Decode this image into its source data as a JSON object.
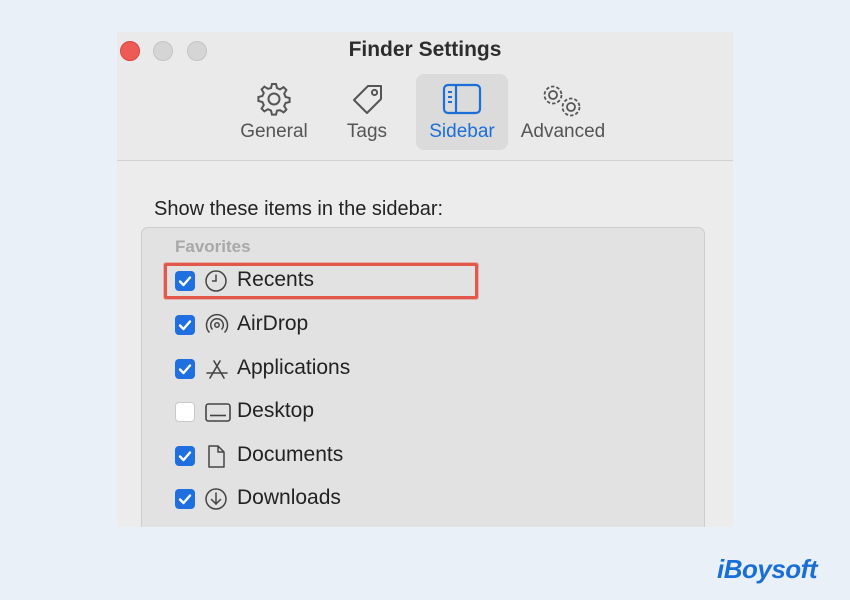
{
  "window": {
    "title": "Finder Settings",
    "tabs": [
      {
        "label": "General",
        "icon": "gear-icon"
      },
      {
        "label": "Tags",
        "icon": "tag-icon"
      },
      {
        "label": "Sidebar",
        "icon": "sidebar-icon",
        "active": true
      },
      {
        "label": "Advanced",
        "icon": "gears-icon"
      }
    ]
  },
  "sidebar_settings": {
    "heading": "Show these items in the sidebar:",
    "section": "Favorites",
    "items": [
      {
        "label": "Recents",
        "checked": true,
        "icon": "clock-icon"
      },
      {
        "label": "AirDrop",
        "checked": true,
        "icon": "airdrop-icon"
      },
      {
        "label": "Applications",
        "checked": true,
        "icon": "applications-icon"
      },
      {
        "label": "Desktop",
        "checked": false,
        "icon": "desktop-icon"
      },
      {
        "label": "Documents",
        "checked": true,
        "icon": "document-icon"
      },
      {
        "label": "Downloads",
        "checked": true,
        "icon": "download-icon"
      }
    ]
  },
  "brand": {
    "text": "iBoysoft"
  },
  "colors": {
    "accent": "#1f6fe0",
    "highlight": "#e4574b",
    "close": "#ee5b57"
  }
}
